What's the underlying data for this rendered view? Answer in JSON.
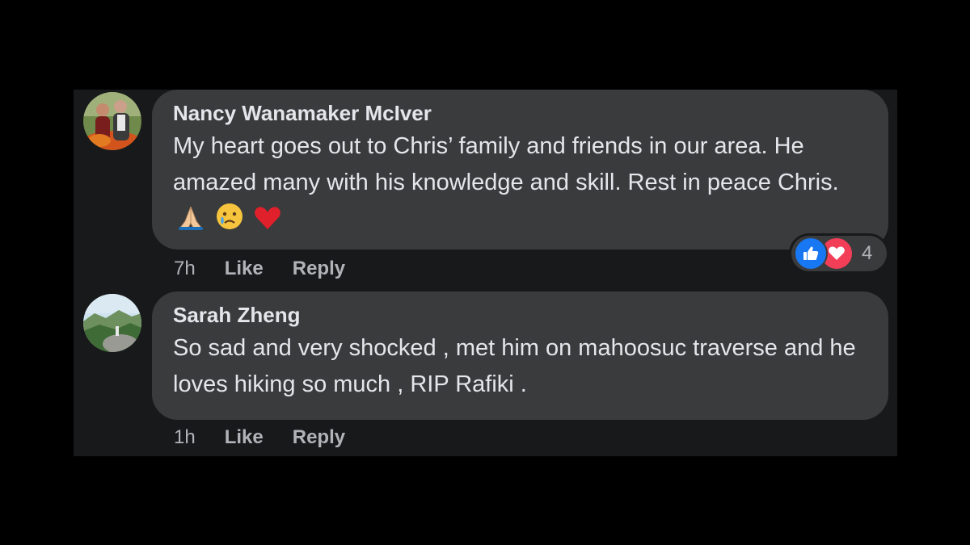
{
  "comments": [
    {
      "author": "Nancy Wanamaker McIver",
      "text": "My heart goes out to Chris’ family and friends in our area. He amazed many with his knowledge and skill. Rest in peace Chris.",
      "emojis": [
        "folded-hands-emoji",
        "crying-face-emoji",
        "red-heart-emoji"
      ],
      "time": "7h",
      "like_label": "Like",
      "reply_label": "Reply",
      "reactions": {
        "types": [
          "like-icon",
          "love-icon"
        ],
        "count": "4"
      }
    },
    {
      "author": "Sarah Zheng",
      "text": "So sad and very shocked , met him on mahoosuc traverse and he loves hiking so much , RIP Rafiki .",
      "time": "1h",
      "like_label": "Like",
      "reply_label": "Reply"
    }
  ],
  "colors": {
    "background": "#000000",
    "panel": "#18191a",
    "bubble": "#3a3b3c",
    "text": "#e4e6eb",
    "meta": "#b0b3b8",
    "like_blue": "#1877f2",
    "love_red": "#f33e58"
  }
}
